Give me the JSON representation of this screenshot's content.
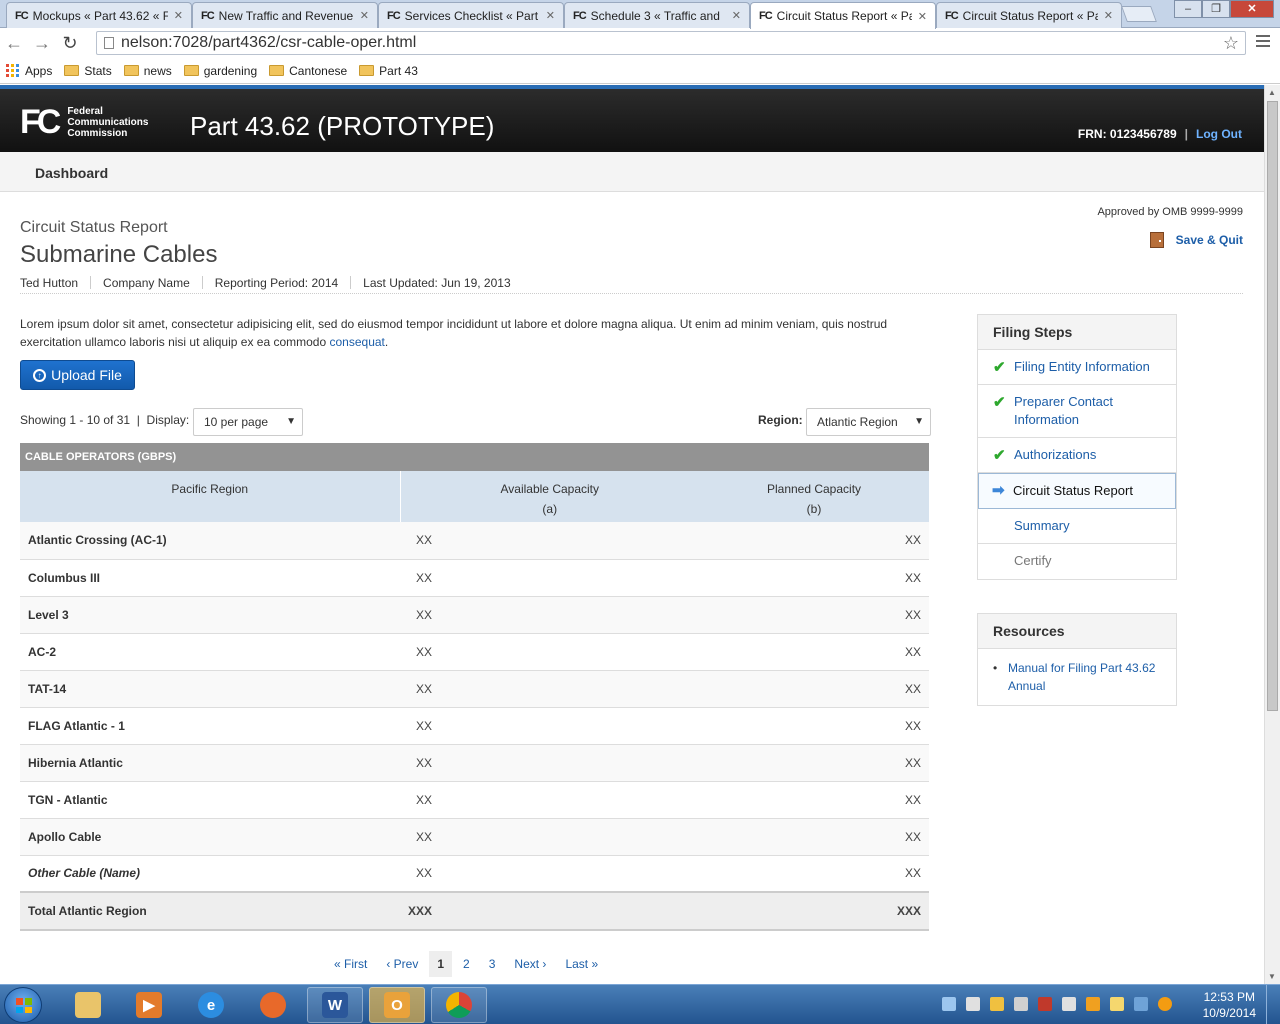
{
  "browser": {
    "tabs": [
      {
        "favicon": "FC",
        "title": "Mockups « Part 43.62 « F"
      },
      {
        "favicon": "FC",
        "title": "New Traffic and Revenue"
      },
      {
        "favicon": "FC",
        "title": "Services Checklist « Part"
      },
      {
        "favicon": "FC",
        "title": "Schedule 3 « Traffic and"
      },
      {
        "favicon": "FC",
        "title": "Circuit Status Report « Pa"
      },
      {
        "favicon": "FC",
        "title": "Circuit Status Report « Pa"
      }
    ],
    "url": "nelson:7028/part4362/csr-cable-oper.html",
    "bookmarks": [
      "Apps",
      "Stats",
      "news",
      "gardening",
      "Cantonese",
      "Part 43"
    ]
  },
  "header": {
    "logo_mark": "FC",
    "agency_line1": "Federal",
    "agency_line2": "Communications",
    "agency_line3": "Commission",
    "app_title": "Part 43.62 (PROTOTYPE)",
    "frn": "FRN: 0123456789",
    "separator": "|",
    "logout": "Log Out"
  },
  "subnav": {
    "dashboard": "Dashboard"
  },
  "omb": "Approved by OMB 9999-9999",
  "save_quit": "Save & Quit",
  "report": {
    "type": "Circuit Status Report",
    "title": "Submarine Cables",
    "user": "Ted Hutton",
    "company": "Company Name",
    "period": "Reporting Period: 2014",
    "updated": "Last Updated: Jun 19, 2013"
  },
  "intro": {
    "text": "Lorem ipsum dolor sit amet, consectetur adipisicing elit, sed do eiusmod tempor incididunt ut labore et dolore magna aliqua. Ut enim ad minim veniam, quis nostrud exercitation ullamco laboris nisi ut aliquip ex ea commodo ",
    "link": "consequat",
    "end": "."
  },
  "upload": {
    "label": "Upload File"
  },
  "listing": {
    "showing": "Showing 1 - 10 of 31  |  Display:",
    "per_page": "10 per page",
    "region_label": "Region:",
    "region_value": "Atlantic Region"
  },
  "table": {
    "group_header": "CABLE OPERATORS (GBPS)",
    "col1": "Pacific Region",
    "col2": "Available Capacity",
    "col2_sub": "(a)",
    "col3": "Planned Capacity",
    "col3_sub": "(b)",
    "rows": [
      {
        "name": "Atlantic Crossing (AC-1)",
        "a": "XX",
        "b": "XX"
      },
      {
        "name": "Columbus III",
        "a": "XX",
        "b": "XX"
      },
      {
        "name": "Level 3",
        "a": "XX",
        "b": "XX"
      },
      {
        "name": "AC-2",
        "a": "XX",
        "b": "XX"
      },
      {
        "name": "TAT-14",
        "a": "XX",
        "b": "XX"
      },
      {
        "name": "FLAG Atlantic - 1",
        "a": "XX",
        "b": "XX"
      },
      {
        "name": "Hibernia Atlantic",
        "a": "XX",
        "b": "XX"
      },
      {
        "name": "TGN - Atlantic",
        "a": "XX",
        "b": "XX"
      },
      {
        "name": "Apollo Cable",
        "a": "XX",
        "b": "XX"
      },
      {
        "name": "Other Cable (Name)",
        "a": "XX",
        "b": "XX"
      }
    ],
    "total": {
      "name": "Total Atlantic Region",
      "a": "XXX",
      "b": "XXX"
    }
  },
  "pager": {
    "first": "« First",
    "prev": "‹ Prev",
    "p1": "1",
    "p2": "2",
    "p3": "3",
    "next": "Next ›",
    "last": "Last »"
  },
  "filing_steps": {
    "title": "Filing Steps",
    "steps": [
      "Filing Entity Information",
      "Preparer Contact Information",
      "Authorizations",
      "Circuit Status Report",
      "Summary",
      "Certify"
    ]
  },
  "resources": {
    "title": "Resources",
    "items": [
      "Manual for Filing Part 43.62 Annual"
    ]
  },
  "taskbar": {
    "time": "12:53 PM",
    "date": "10/9/2014"
  },
  "colors": {
    "accent": "#1d5ea8",
    "check": "#2ea82e",
    "table_header": "#939393",
    "column_header": "#d6e2ee"
  }
}
